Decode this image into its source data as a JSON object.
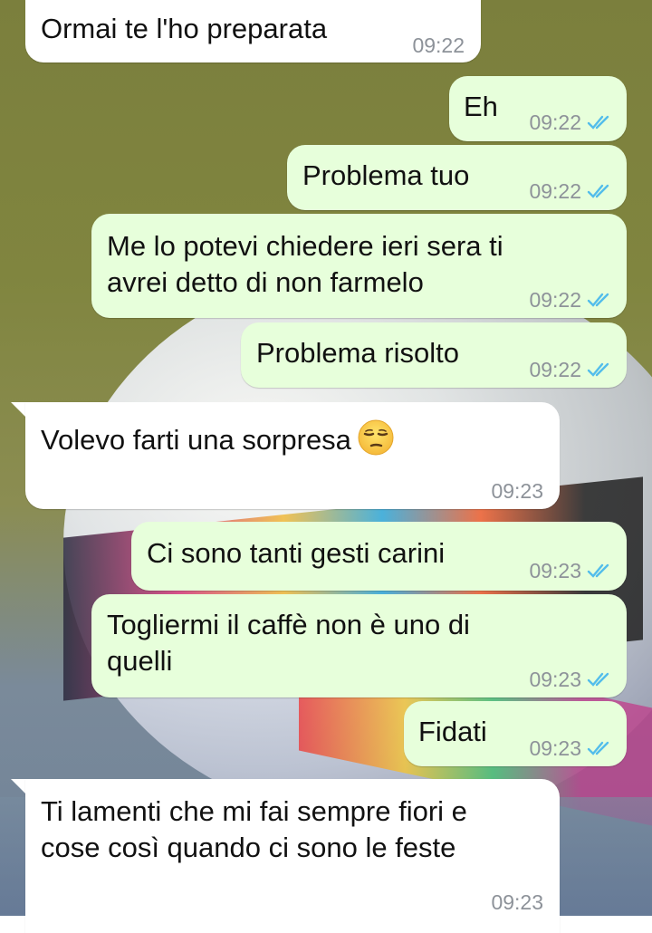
{
  "messages": [
    {
      "direction": "in",
      "text": "Ormai te l'ho preparata",
      "time": "09:22"
    },
    {
      "direction": "out",
      "text": "Eh",
      "time": "09:22",
      "status": "read"
    },
    {
      "direction": "out",
      "text": "Problema tuo",
      "time": "09:22",
      "status": "read"
    },
    {
      "direction": "out",
      "text": "Me lo potevi chiedere ieri sera ti\navrei detto di non farmelo",
      "time": "09:22",
      "status": "read"
    },
    {
      "direction": "out",
      "text": "Problema risolto",
      "time": "09:22",
      "status": "read"
    },
    {
      "direction": "in",
      "text": "Volevo farti una sorpresa",
      "emoji": "unamused-face",
      "time": "09:23"
    },
    {
      "direction": "out",
      "text": "Ci sono tanti gesti carini",
      "time": "09:23",
      "status": "read"
    },
    {
      "direction": "out",
      "text": "Togliermi il caffè non è uno di\nquelli",
      "time": "09:23",
      "status": "read"
    },
    {
      "direction": "out",
      "text": "Fidati",
      "time": "09:23",
      "status": "read"
    },
    {
      "direction": "in",
      "text": "Ti lamenti che mi fai sempre fiori e\ncose così quando ci sono le feste",
      "time": "09:23"
    }
  ],
  "colors": {
    "incoming_bubble": "#ffffff",
    "outgoing_bubble": "#e7ffdb",
    "read_tick": "#53bdeb",
    "timestamp": "#8d9299"
  },
  "wallpaper": "soccer-ball-photo"
}
